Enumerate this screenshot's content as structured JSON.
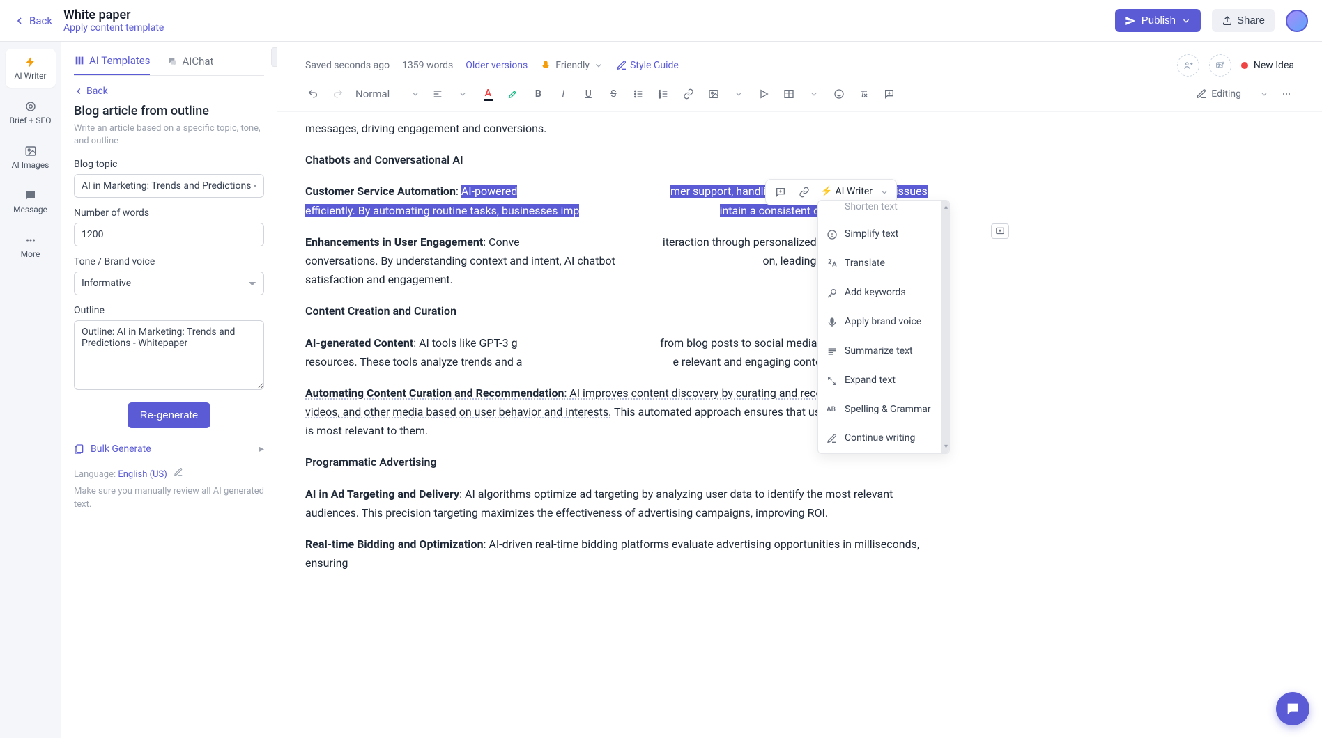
{
  "topbar": {
    "back": "Back",
    "title": "White paper",
    "subtitle_link": "Apply content template",
    "publish": "Publish",
    "share": "Share"
  },
  "rail": {
    "ai_writer": "AI Writer",
    "brief_seo": "Brief + SEO",
    "ai_images": "AI Images",
    "message": "Message",
    "more": "More"
  },
  "panel": {
    "tab1": "AI Templates",
    "tab2": "AIChat",
    "back": "Back",
    "title": "Blog article from outline",
    "desc": "Write an article based on a specific topic, tone, and outline",
    "f_topic_label": "Blog topic",
    "f_topic_value": "AI in Marketing: Trends and Predictions - Whitepaper",
    "f_words_label": "Number of words",
    "f_words_value": "1200",
    "f_tone_label": "Tone / Brand voice",
    "f_tone_value": "Informative",
    "f_outline_label": "Outline",
    "f_outline_value": "Outline: AI in Marketing: Trends and Predictions - Whitepaper",
    "regenerate": "Re-generate",
    "bulk": "Bulk Generate",
    "lang_prefix": "Language: ",
    "lang_value": "English (US)",
    "note": "Make sure you manually review all AI generated text."
  },
  "editor_top": {
    "saved": "Saved seconds ago",
    "word_count": "1359 words",
    "older_versions": "Older versions",
    "tone": "Friendly",
    "style_guide": "Style Guide",
    "status": "New Idea"
  },
  "toolbar": {
    "style": "Normal",
    "editing": "Editing"
  },
  "floatbar": {
    "ai_writer": "AI Writer"
  },
  "dropdown": {
    "clipped_top": "Shorten text",
    "items": [
      "Simplify text",
      "Translate",
      "Add keywords",
      "Apply brand voice",
      "Summarize text",
      "Expand text",
      "Spelling & Grammar",
      "Continue writing"
    ]
  },
  "doc": {
    "p0": "messages, driving engagement and conversions.",
    "h1": "Chatbots and Conversational AI",
    "csa_label": "Customer Service Automation",
    "csa_sel_pre": ": ",
    "csa_sel1": "AI-powered",
    "csa_mid1": "mer support, handling inquiries and resolving issues efficiently. ",
    "csa_sel2": "By automating routine tasks, businesses imp",
    "csa_mid2": "intain a consistent customer experience.",
    "eue_label": "Enhancements in User Engagement",
    "eue_txt1": ": Conve",
    "eue_txt2": "iteraction through personalized and dynamic conversations. By understanding context and intent, AI chatbot",
    "eue_txt3": "on, leading to higher user satisfaction and engagement.",
    "h2": "Content Creation and Curation",
    "ai_gen_label": "AI-generated Content",
    "ai_gen_txt1": ": AI tools like GPT-3 g",
    "ai_gen_txt2": " from blog posts to social media updates, saving time and resources. These tools analyze trends and a",
    "ai_gen_txt3": "e relevant and engaging content.",
    "auto_label": "Automating Content Curation and Recommendation",
    "auto_txt1": ": AI improves content discovery by curating and recommending articles, videos, and other media based on user behavior and interests.",
    "auto_txt2": " This automated approach ensures that users receive content ",
    "auto_txt3": "that is",
    "auto_txt4": " most relevant to them.",
    "h3": "Programmatic Advertising",
    "ad_label": "AI in Ad Targeting and Delivery",
    "ad_txt": ": AI algorithms optimize ad targeting by analyzing user data to identify the most relevant audiences. This precision targeting maximizes the effectiveness of advertising campaigns, improving ROI.",
    "rtb_label": "Real-time Bidding and Optimization",
    "rtb_txt": ": AI-driven real-time bidding platforms evaluate advertising opportunities in milliseconds, ensuring"
  }
}
